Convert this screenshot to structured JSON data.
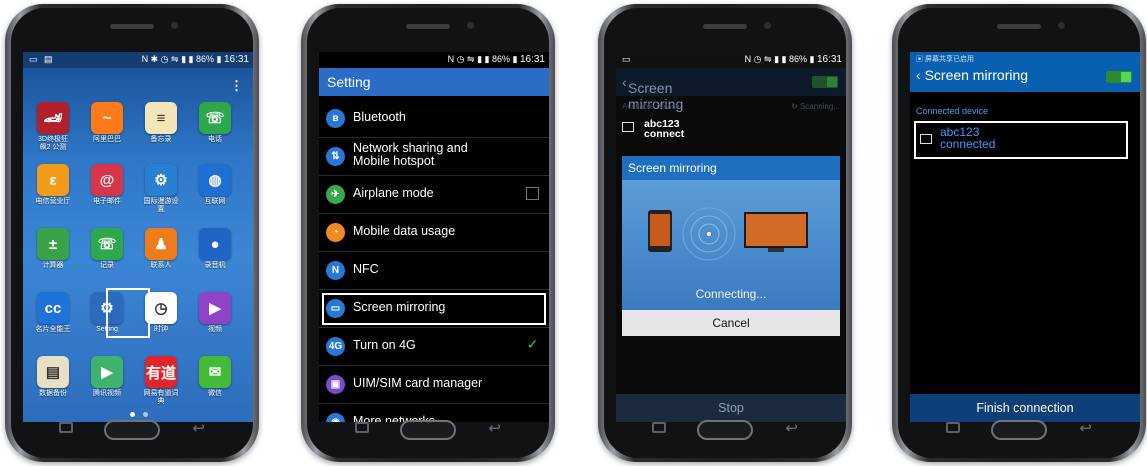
{
  "phone1": {
    "status_time": "16:31",
    "status_battery": "86%",
    "apps": [
      {
        "label": "3D终极狂\n飙2 公测",
        "icon": "race-car-icon",
        "glyph": "🏎",
        "color": "#b31f2a"
      },
      {
        "label": "阿里巴巴",
        "icon": "alibaba-icon",
        "glyph": "~",
        "color": "#ff7a1a"
      },
      {
        "label": "备忘录",
        "icon": "memo-icon",
        "glyph": "≡",
        "color": "#f2e6b8"
      },
      {
        "label": "电话",
        "icon": "phone-icon",
        "glyph": "☏",
        "color": "#2ea84a"
      },
      {
        "label": "电信营业厅",
        "icon": "telecom-icon",
        "glyph": "ε",
        "color": "#f29a1a"
      },
      {
        "label": "电子邮件",
        "icon": "email-icon",
        "glyph": "@",
        "color": "#d8344a"
      },
      {
        "label": "国际漫游设\n置",
        "icon": "roaming-icon",
        "glyph": "⚙",
        "color": "#2a7fd1"
      },
      {
        "label": "互联网",
        "icon": "internet-icon",
        "glyph": "◍",
        "color": "#1d6fd2"
      },
      {
        "label": "计算器",
        "icon": "calculator-icon",
        "glyph": "±",
        "color": "#3aa34a"
      },
      {
        "label": "记录",
        "icon": "call-log-icon",
        "glyph": "☏",
        "color": "#2fa74c"
      },
      {
        "label": "联系人",
        "icon": "contacts-icon",
        "glyph": "♟",
        "color": "#ef7c1a"
      },
      {
        "label": "录音机",
        "icon": "recorder-icon",
        "glyph": "●",
        "color": "#2165c4"
      },
      {
        "label": "名片全能王",
        "icon": "camcard-icon",
        "glyph": "cc",
        "color": "#1f73d8"
      },
      {
        "label": "Setting",
        "icon": "settings-gear-icon",
        "glyph": "⚙",
        "color": "#2b6bbd"
      },
      {
        "label": "时钟",
        "icon": "clock-icon",
        "glyph": "◷",
        "color": "#ffffff"
      },
      {
        "label": "视频",
        "icon": "video-icon",
        "glyph": "▶",
        "color": "#8f44c8"
      },
      {
        "label": "数据备份",
        "icon": "backup-icon",
        "glyph": "▤",
        "color": "#e8e0c2"
      },
      {
        "label": "腾讯视频",
        "icon": "tencent-video-icon",
        "glyph": "▶",
        "color": "#3fb36b"
      },
      {
        "label": "网易有道词\n典",
        "icon": "youdao-icon",
        "glyph": "有道",
        "color": "#e0262a"
      },
      {
        "label": "微信",
        "icon": "wechat-icon",
        "glyph": "✉",
        "color": "#45b938"
      }
    ]
  },
  "phone2": {
    "status_time": "16:31",
    "status_battery": "86%",
    "title": "Setting",
    "rows": [
      {
        "label": "Bluetooth",
        "icon": "bluetooth-icon",
        "glyph": "ʙ",
        "color": "#2a78d6",
        "check": ""
      },
      {
        "label": "Network sharing and\nMobile hotspot",
        "icon": "hotspot-icon",
        "glyph": "⇅",
        "color": "#2a78d6",
        "check": ""
      },
      {
        "label": "Airplane mode",
        "icon": "airplane-icon",
        "glyph": "✈",
        "color": "#3aa94a",
        "check": "off"
      },
      {
        "label": "Mobile data usage",
        "icon": "data-usage-icon",
        "glyph": "◔",
        "color": "#f08a22",
        "check": ""
      },
      {
        "label": "NFC",
        "icon": "nfc-icon",
        "glyph": "N",
        "color": "#2a78d6",
        "check": ""
      },
      {
        "label": "Screen mirroring",
        "icon": "screen-mirroring-icon",
        "glyph": "▭",
        "color": "#2a78d6",
        "check": ""
      },
      {
        "label": "Turn on 4G",
        "icon": "4g-icon",
        "glyph": "4G",
        "color": "#2a78d6",
        "check": "on"
      },
      {
        "label": "UIM/SIM card manager",
        "icon": "sim-card-icon",
        "glyph": "▣",
        "color": "#7a4bc6",
        "check": ""
      },
      {
        "label": "More networks",
        "icon": "more-networks-icon",
        "glyph": "◉",
        "color": "#2a78d6",
        "check": ""
      }
    ]
  },
  "phone3": {
    "status_time": "16:31",
    "status_battery": "86%",
    "title": "Screen mirroring",
    "available_device": "Available device",
    "scanning": "Scanning...",
    "device_name": "abc123",
    "device_status": "connect",
    "dialog_title": "Screen mirroring",
    "connecting": "Connecting...",
    "cancel": "Cancel",
    "stop": "Stop"
  },
  "phone4": {
    "top_text": "屏幕共享已启用",
    "title": "Screen mirroring",
    "connected_device": "Connected device",
    "device_name": "abc123",
    "device_status": "connected",
    "finish": "Finish connection"
  }
}
